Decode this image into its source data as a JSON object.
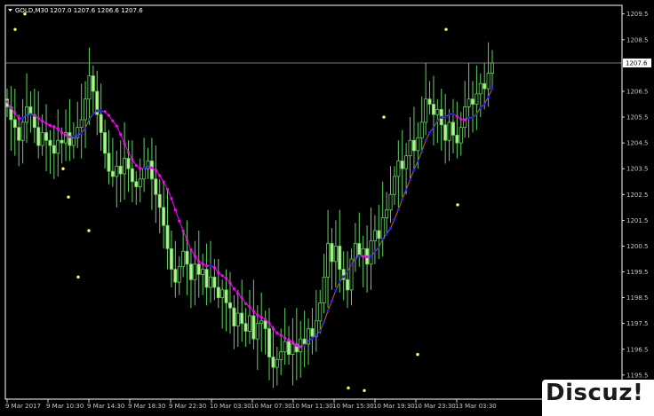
{
  "header": {
    "symbol": "GOLD,M30",
    "ohlc": "1207.0 1207.6 1206.6 1207.6"
  },
  "watermark": "Discuz!",
  "current_price_label": "1207.6",
  "colors": {
    "background": "#000000",
    "frame": "#ffffff",
    "candle": "#5fd35f",
    "candle_fill": "#b8f08a",
    "ma_down": "#ff00ff",
    "ma_up": "#1e1eff",
    "ma_link": "#c8641e",
    "fractal": "#ffff55",
    "bid_line": "#a0a0a0"
  },
  "chart_data": {
    "type": "candlestick",
    "ylim": [
      1194.6,
      1209.8
    ],
    "y_ticks": [
      "1209.5",
      "1208.5",
      "1207.6",
      "1206.5",
      "1205.5",
      "1204.5",
      "1203.5",
      "1202.5",
      "1201.5",
      "1200.5",
      "1199.5",
      "1198.5",
      "1197.5",
      "1196.5",
      "1195.5"
    ],
    "x_ticks": [
      "9 Mar 2017",
      "9 Mar 10:30",
      "9 Mar 14:30",
      "9 Mar 18:30",
      "9 Mar 22:30",
      "10 Mar 03:30",
      "10 Mar 07:30",
      "10 Mar 11:30",
      "10 Mar 15:30",
      "10 Mar 19:30",
      "10 Mar 23:30",
      "13 Mar 03:30"
    ],
    "close": [
      1205.9,
      1205.4,
      1205.1,
      1204.6,
      1205.3,
      1205.9,
      1205.6,
      1205.1,
      1204.4,
      1204.9,
      1204.6,
      1204.4,
      1204.1,
      1204.6,
      1204.5,
      1204.9,
      1204.4,
      1204.7,
      1205.1,
      1205.4,
      1206.2,
      1207.1,
      1206.5,
      1205.6,
      1204.9,
      1204.1,
      1203.4,
      1203.2,
      1203.6,
      1203.3,
      1203.9,
      1203.5,
      1203.0,
      1202.8,
      1203.1,
      1203.5,
      1203.8,
      1203.1,
      1202.5,
      1202.0,
      1201.3,
      1200.4,
      1199.6,
      1199.1,
      1199.7,
      1200.3,
      1199.8,
      1199.2,
      1199.8,
      1199.4,
      1199.6,
      1198.9,
      1199.3,
      1198.9,
      1198.5,
      1198.8,
      1198.3,
      1198.1,
      1197.4,
      1197.9,
      1197.5,
      1197.2,
      1197.8,
      1196.9,
      1197.5,
      1197.6,
      1197.3,
      1196.2,
      1195.8,
      1196.1,
      1196.4,
      1196.8,
      1196.3,
      1196.7,
      1196.4,
      1196.9,
      1196.7,
      1197.3,
      1197.0,
      1197.6,
      1198.3,
      1199.3,
      1200.6,
      1199.9,
      1200.5,
      1199.6,
      1199.2,
      1198.8,
      1200.0,
      1200.6,
      1200.1,
      1200.4,
      1199.8,
      1200.7,
      1201.1,
      1200.8,
      1201.6,
      1201.9,
      1202.5,
      1203.2,
      1203.8,
      1203.5,
      1204.0,
      1204.6,
      1204.2,
      1204.7,
      1205.3,
      1206.2,
      1206.0,
      1205.6,
      1205.8,
      1205.2,
      1204.6,
      1205.3,
      1204.8,
      1204.5,
      1205.1,
      1205.9,
      1206.2,
      1206.0,
      1206.4,
      1206.8,
      1206.6,
      1207.2,
      1207.6
    ],
    "fractals": [
      [
        17,
        1208.9
      ],
      [
        28,
        1209.5
      ],
      [
        71,
        1203.5
      ],
      [
        88,
        1199.3
      ],
      [
        77,
        1202.4
      ],
      [
        100,
        1201.1
      ],
      [
        392,
        1195.0
      ],
      [
        410,
        1194.9
      ],
      [
        432,
        1205.5
      ],
      [
        470,
        1196.3
      ],
      [
        502,
        1208.9
      ],
      [
        515,
        1202.1
      ]
    ]
  }
}
